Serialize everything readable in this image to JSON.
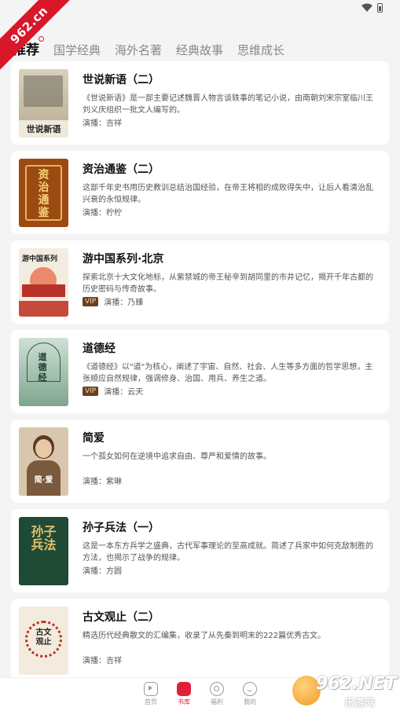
{
  "corner_badge": "962.cn",
  "tabs": [
    {
      "label": "推荐",
      "active": true
    },
    {
      "label": "国学经典",
      "active": false
    },
    {
      "label": "海外名著",
      "active": false
    },
    {
      "label": "经典故事",
      "active": false
    },
    {
      "label": "思维成长",
      "active": false
    }
  ],
  "books": [
    {
      "title": "世说新语（二）",
      "desc": "《世说新语》是一部主要记述魏晋人物言谈轶事的笔记小说，由南朝刘宋宗室临川王刘义庆组织一批文人编写的。",
      "narrator": "演播：吉祥",
      "vip": false,
      "cover_text": "世说新语"
    },
    {
      "title": "资治通鉴（二）",
      "desc": "这部千年史书用历史教训总结治国经验，在帝王将相的成败得失中，让后人看清治乱兴衰的永恒规律。",
      "narrator": "演播：柠柠",
      "vip": false,
      "cover_text": "资治通鉴"
    },
    {
      "title": "游中国系列·北京",
      "desc": "探索北京十大文化地标，从紫禁城的帝王秘辛到胡同里的市井记忆，揭开千年古都的历史密码与传奇故事。",
      "narrator": "演播：乃臻",
      "vip": true,
      "vip_label": "VIP",
      "cover_text": "游中国系列"
    },
    {
      "title": "道德经",
      "desc": "《道德经》以\"道\"为核心，阐述了宇宙、自然、社会、人生等多方面的哲学思想，主张顺应自然规律，强调修身、治国、用兵、养生之道。",
      "narrator": "演播：云天",
      "vip": true,
      "vip_label": "VIP",
      "cover_text": "道德经"
    },
    {
      "title": "简爱",
      "desc": "一个孤女如何在逆境中追求自由、尊严和爱情的故事。",
      "narrator": "演播：紫琳",
      "vip": false,
      "cover_text": "简·爱"
    },
    {
      "title": "孙子兵法（一）",
      "desc": "这是一本东方兵学之盛典，古代军事理论的至高成就。简述了兵家中如何克敌制胜的方法，也揭示了战争的规律。",
      "narrator": "演播：方圆",
      "vip": false,
      "cover_text": "孙子兵法"
    },
    {
      "title": "古文观止（二）",
      "desc": "精选历代经典散文的汇编集，收录了从先秦到明末的222篇优秀古文。",
      "narrator": "演播：吉祥",
      "vip": false,
      "cover_text": "古文观止"
    }
  ],
  "nav": [
    {
      "label": "首页",
      "icon": "play-icon",
      "active": false
    },
    {
      "label": "书库",
      "icon": "book-icon",
      "active": true
    },
    {
      "label": "福利",
      "icon": "gift-icon",
      "active": false
    },
    {
      "label": "我的",
      "icon": "smile-icon",
      "active": false
    }
  ],
  "watermark": {
    "brand": "962.NET",
    "sub": "乐游网"
  },
  "colors": {
    "accent": "#e0203a",
    "vip_bg": "#6b3e22"
  }
}
